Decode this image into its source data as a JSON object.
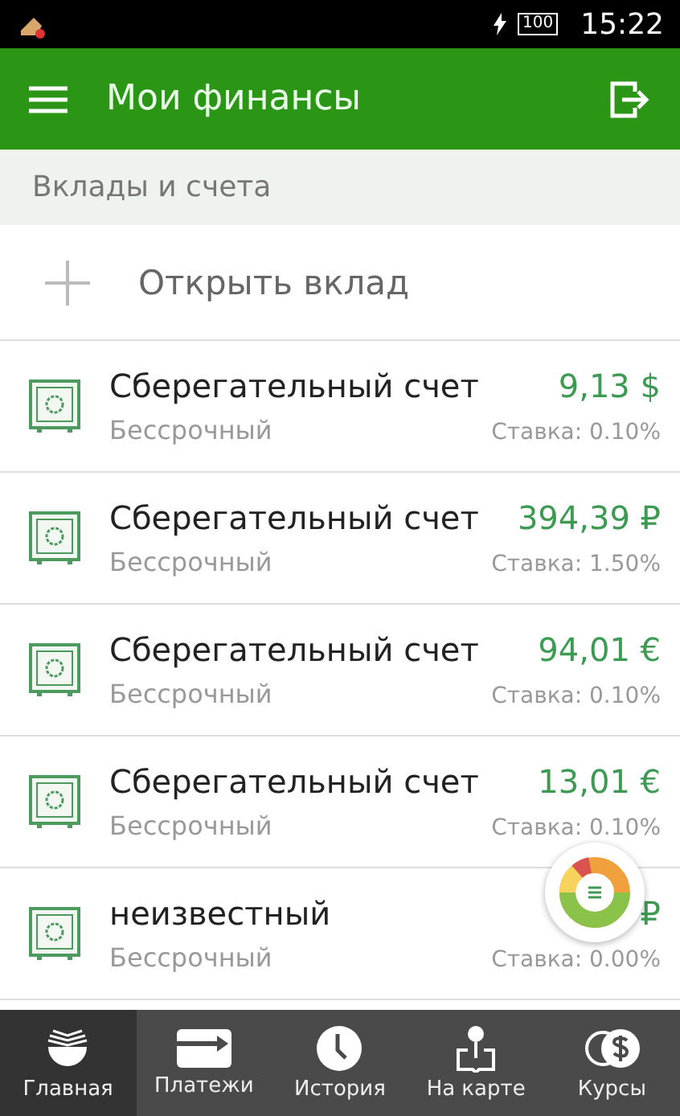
{
  "status_bar": {
    "battery": "100",
    "time": "15:22"
  },
  "header": {
    "title": "Мои финансы"
  },
  "section": {
    "title": "Вклады и счета"
  },
  "open_deposit": {
    "label": "Открыть вклад"
  },
  "accounts": [
    {
      "name": "Сберегательный счет",
      "amount": "9,13 $",
      "term": "Бессрочный",
      "rate": "Ставка: 0.10%"
    },
    {
      "name": "Сберегательный счет",
      "amount": "394,39 ₽",
      "term": "Бессрочный",
      "rate": "Ставка: 1.50%"
    },
    {
      "name": "Сберегательный счет",
      "amount": "94,01 €",
      "term": "Бессрочный",
      "rate": "Ставка: 0.10%"
    },
    {
      "name": "Сберегательный счет",
      "amount": "13,01 €",
      "term": "Бессрочный",
      "rate": "Ставка: 0.10%"
    },
    {
      "name": "неизвестный",
      "amount": "₽",
      "term": "Бессрочный",
      "rate": "Ставка: 0.00%"
    }
  ],
  "bottom_nav": [
    {
      "label": "Главная",
      "kind": "home",
      "selected": true
    },
    {
      "label": "Платежи",
      "kind": "payments",
      "selected": false
    },
    {
      "label": "История",
      "kind": "history",
      "selected": false
    },
    {
      "label": "На карте",
      "kind": "map",
      "selected": false
    },
    {
      "label": "Курсы",
      "kind": "rates",
      "selected": false
    }
  ]
}
